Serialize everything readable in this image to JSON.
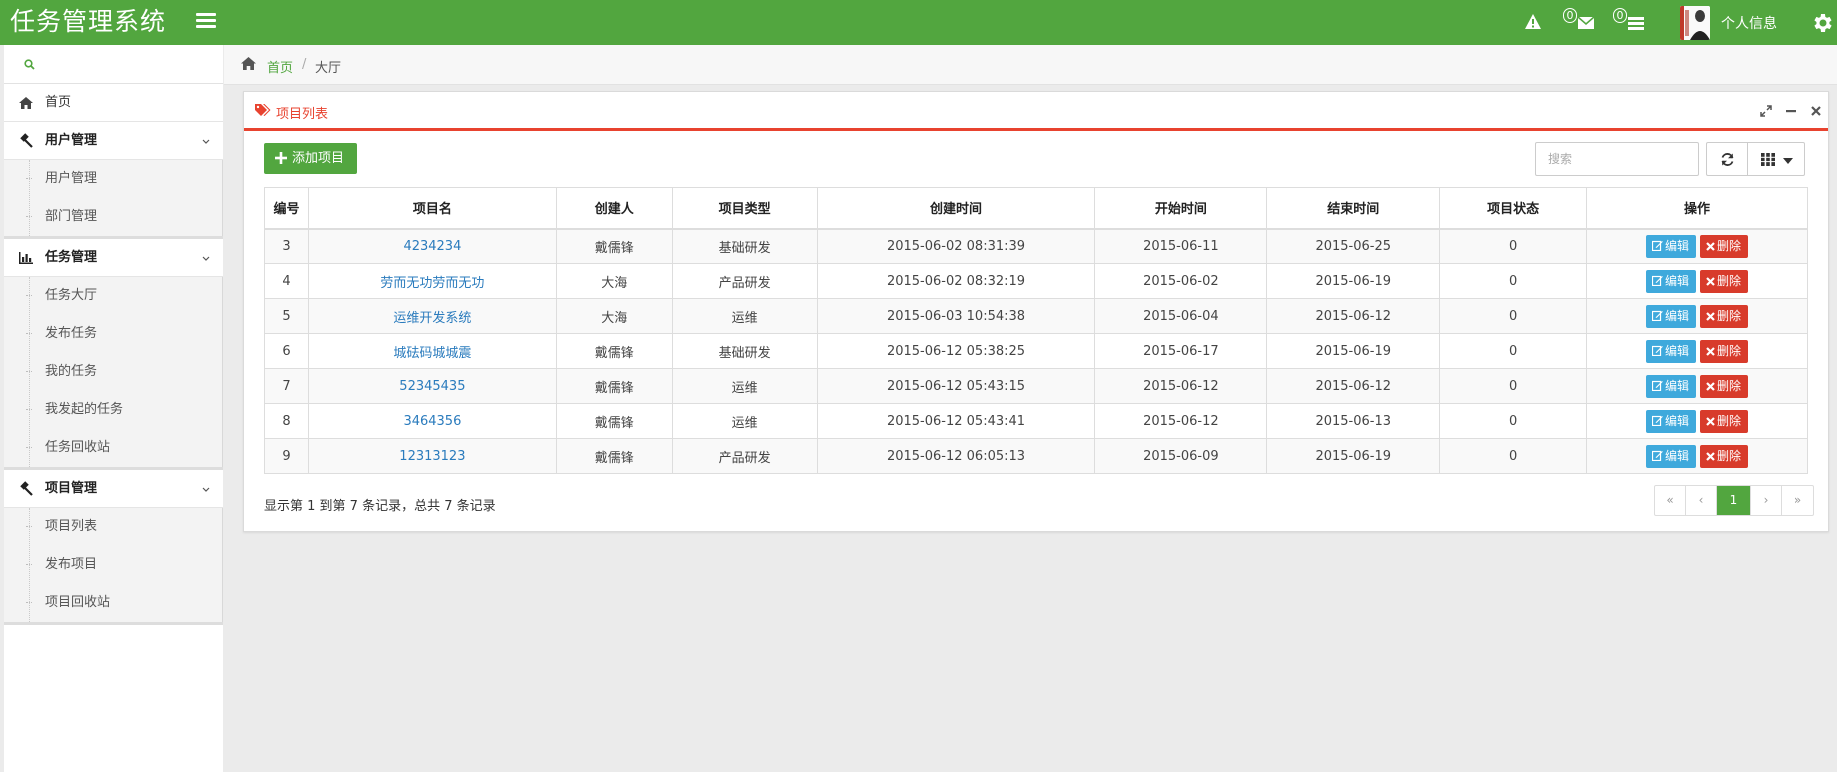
{
  "app": {
    "title": "任务管理系统"
  },
  "header": {
    "alerts_badge": "",
    "messages_badge": "0",
    "tasks_badge": "0",
    "profile_label": "个人信息",
    "brand_color": "#52a63f"
  },
  "sidebar": {
    "search_icon": "search-icon",
    "home": {
      "label": "首页",
      "icon": "home-icon"
    },
    "groups": [
      {
        "label": "用户管理",
        "icon": "gavel-icon",
        "items": [
          "用户管理",
          "部门管理"
        ]
      },
      {
        "label": "任务管理",
        "icon": "bar-chart-icon",
        "items": [
          "任务大厅",
          "发布任务",
          "我的任务",
          "我发起的任务",
          "任务回收站"
        ]
      },
      {
        "label": "项目管理",
        "icon": "gavel-icon",
        "items": [
          "项目列表",
          "发布项目",
          "项目回收站"
        ]
      }
    ]
  },
  "breadcrumb": {
    "home": "首页",
    "separator": "/",
    "current": "大厅"
  },
  "panel": {
    "title": "项目列表",
    "accent_color": "#e8432f",
    "add_button": "添加项目",
    "search_placeholder": "搜索",
    "columns": [
      "编号",
      "项目名",
      "创建人",
      "项目类型",
      "创建时间",
      "开始时间",
      "结束时间",
      "项目状态",
      "操作"
    ],
    "rows": [
      {
        "id": "3",
        "name": "4234234",
        "creator": "戴儒锋",
        "type": "基础研发",
        "created": "2015-06-02 08:31:39",
        "start": "2015-06-11",
        "end": "2015-06-25",
        "status": "0"
      },
      {
        "id": "4",
        "name": "劳而无功劳而无功",
        "creator": "大海",
        "type": "产品研发",
        "created": "2015-06-02 08:32:19",
        "start": "2015-06-02",
        "end": "2015-06-19",
        "status": "0"
      },
      {
        "id": "5",
        "name": "运维开发系统",
        "creator": "大海",
        "type": "运维",
        "created": "2015-06-03 10:54:38",
        "start": "2015-06-04",
        "end": "2015-06-12",
        "status": "0"
      },
      {
        "id": "6",
        "name": "城砝码城城震",
        "creator": "戴儒锋",
        "type": "基础研发",
        "created": "2015-06-12 05:38:25",
        "start": "2015-06-17",
        "end": "2015-06-19",
        "status": "0"
      },
      {
        "id": "7",
        "name": "52345435",
        "creator": "戴儒锋",
        "type": "运维",
        "created": "2015-06-12 05:43:15",
        "start": "2015-06-12",
        "end": "2015-06-12",
        "status": "0"
      },
      {
        "id": "8",
        "name": "3464356",
        "creator": "戴儒锋",
        "type": "运维",
        "created": "2015-06-12 05:43:41",
        "start": "2015-06-12",
        "end": "2015-06-13",
        "status": "0"
      },
      {
        "id": "9",
        "name": "12313123",
        "creator": "戴儒锋",
        "type": "产品研发",
        "created": "2015-06-12 06:05:13",
        "start": "2015-06-09",
        "end": "2015-06-19",
        "status": "0"
      }
    ],
    "edit_label": "编辑",
    "delete_label": "删除",
    "summary": "显示第 1 到第 7 条记录，总共 7 条记录",
    "pagination": {
      "first": "«",
      "prev": "‹",
      "current": "1",
      "next": "›",
      "last": "»"
    }
  }
}
